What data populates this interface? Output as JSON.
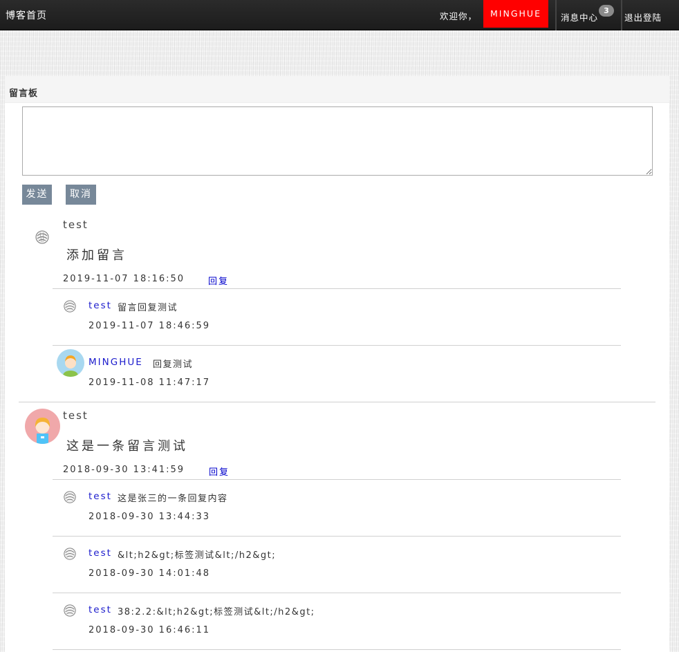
{
  "nav": {
    "brand": "博客首页",
    "welcome": "欢迎你，",
    "username": "MINGHUE",
    "message_center": "消息中心",
    "message_count": "3",
    "logout": "退出登陆"
  },
  "board": {
    "title": "留言板",
    "textarea_value": "",
    "send_label": "发送",
    "cancel_label": "取消"
  },
  "comments": [
    {
      "author": "test",
      "text": "添加留言",
      "time": "2019-11-07 18:16:50",
      "reply_label": "回复",
      "replies": [
        {
          "author": "test",
          "text": "留言回复测试",
          "time": "2019-11-07 18:46:59"
        },
        {
          "author": "MINGHUE",
          "text": "回复测试",
          "time": "2019-11-08 11:47:17"
        }
      ]
    },
    {
      "author": "test",
      "text": "这是一条留言测试",
      "time": "2018-09-30 13:41:59",
      "reply_label": "回复",
      "replies": [
        {
          "author": "test",
          "text": "这是张三的一条回复内容",
          "time": "2018-09-30 13:44:33"
        },
        {
          "author": "test",
          "text": "&lt;h2&gt;标签测试&lt;/h2&gt;",
          "time": "2018-09-30 14:01:48"
        },
        {
          "author": "test",
          "text": "38:2.2:&lt;h2&gt;标签测试&lt;/h2&gt;",
          "time": "2018-09-30 16:46:11"
        }
      ]
    }
  ],
  "colors": {
    "nav_bg": "#222222",
    "user_highlight": "#ff0000",
    "button_bg": "#778899",
    "link": "#0000cc"
  }
}
